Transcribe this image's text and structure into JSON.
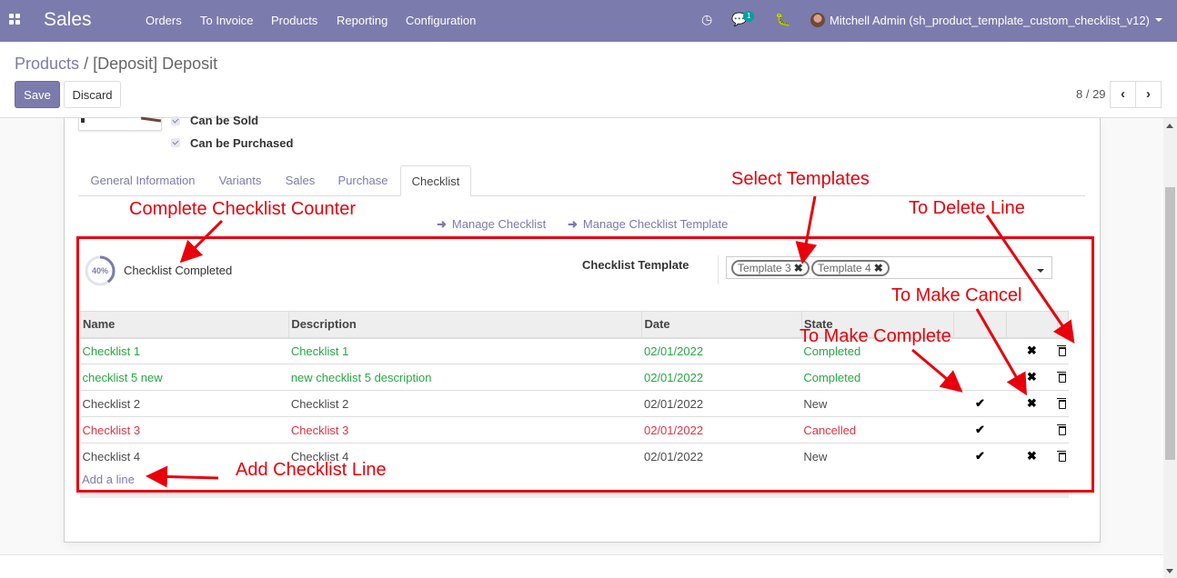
{
  "navbar": {
    "app_name": "Sales",
    "menu": [
      "Orders",
      "To Invoice",
      "Products",
      "Reporting",
      "Configuration"
    ],
    "icons": [
      "clock-icon",
      "chat-icon",
      "bug-icon"
    ],
    "chat_count": "1",
    "user": "Mitchell Admin (sh_product_template_custom_checklist_v12)"
  },
  "breadcrumb": {
    "parent": "Products",
    "separator": "/",
    "current": "[Deposit] Deposit"
  },
  "buttons": {
    "save": "Save",
    "discard": "Discard"
  },
  "pager": {
    "value": "8 / 29"
  },
  "product": {
    "can_be_sold": "Can be Sold",
    "can_be_purchased": "Can be Purchased"
  },
  "tabs": [
    "General Information",
    "Variants",
    "Sales",
    "Purchase",
    "Checklist"
  ],
  "active_tab": "Checklist",
  "links": {
    "manage_checklist": "Manage Checklist",
    "manage_template": "Manage Checklist Template"
  },
  "checklist": {
    "progress_label": "40%",
    "progress_value": 0.4,
    "completed_label": "Checklist Completed",
    "template_label": "Checklist Template",
    "templates": [
      "Template 3",
      "Template 4"
    ],
    "columns": [
      "Name",
      "Description",
      "Date",
      "State",
      "",
      "",
      ""
    ],
    "rows": [
      {
        "name": "Checklist 1",
        "description": "Checklist 1",
        "date": "02/01/2022",
        "state": "Completed"
      },
      {
        "name": "checklist 5 new",
        "description": "new checklist 5 description",
        "date": "02/01/2022",
        "state": "Completed"
      },
      {
        "name": "Checklist 2",
        "description": "Checklist 2",
        "date": "02/01/2022",
        "state": "New"
      },
      {
        "name": "Checklist 3",
        "description": "Checklist 3",
        "date": "02/01/2022",
        "state": "Cancelled"
      },
      {
        "name": "Checklist 4",
        "description": "Checklist 4",
        "date": "02/01/2022",
        "state": "New"
      }
    ],
    "add_line": "Add a line"
  },
  "annotations": {
    "counter": "Complete Checklist Counter",
    "select_templates": "Select Templates",
    "delete_line": "To Delete Line",
    "make_cancel": "To Make Cancel",
    "make_complete": "To Make Complete",
    "add_line": "Add Checklist Line"
  },
  "colors": {
    "brand": "#7c7bad",
    "annotation": "#e8000b",
    "completed": "#28a745",
    "cancelled": "#dc3545"
  }
}
